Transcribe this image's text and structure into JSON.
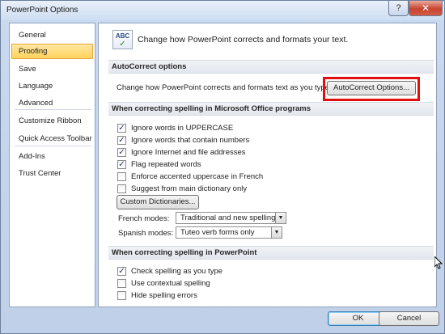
{
  "window": {
    "title": "PowerPoint Options",
    "help_glyph": "?",
    "close_glyph": "✕"
  },
  "sidebar": {
    "items": [
      {
        "label": "General"
      },
      {
        "label": "Proofing"
      },
      {
        "label": "Save"
      },
      {
        "label": "Language"
      },
      {
        "label": "Advanced"
      },
      {
        "label": "Customize Ribbon"
      },
      {
        "label": "Quick Access Toolbar"
      },
      {
        "label": "Add-Ins"
      },
      {
        "label": "Trust Center"
      }
    ],
    "selected": "Proofing"
  },
  "header": {
    "icon_text": "ABC",
    "icon_check": "✓",
    "text": "Change how PowerPoint corrects and formats your text."
  },
  "autocorrect": {
    "section_title": "AutoCorrect options",
    "description": "Change how PowerPoint corrects and formats text as you type:",
    "button_label": "AutoCorrect Options..."
  },
  "office_spelling": {
    "section_title": "When correcting spelling in Microsoft Office programs",
    "options": [
      {
        "label": "Ignore words in UPPERCASE",
        "checked": true
      },
      {
        "label": "Ignore words that contain numbers",
        "checked": true
      },
      {
        "label": "Ignore Internet and file addresses",
        "checked": true
      },
      {
        "label": "Flag repeated words",
        "checked": true
      },
      {
        "label": "Enforce accented uppercase in French",
        "checked": false
      },
      {
        "label": "Suggest from main dictionary only",
        "checked": false
      }
    ],
    "custom_dict_label": "Custom Dictionaries...",
    "french_modes_label": "French modes:",
    "french_modes_value": "Traditional and new spellings",
    "spanish_modes_label": "Spanish modes:",
    "spanish_modes_value": "Tuteo verb forms only"
  },
  "ppt_spelling": {
    "section_title": "When correcting spelling in PowerPoint",
    "options": [
      {
        "label": "Check spelling as you type",
        "checked": true
      },
      {
        "label": "Use contextual spelling",
        "checked": false
      },
      {
        "label": "Hide spelling errors",
        "checked": false
      }
    ]
  },
  "footer": {
    "ok_label": "OK",
    "cancel_label": "Cancel"
  },
  "check_glyph": "✓",
  "dropdown_glyph": "▼"
}
